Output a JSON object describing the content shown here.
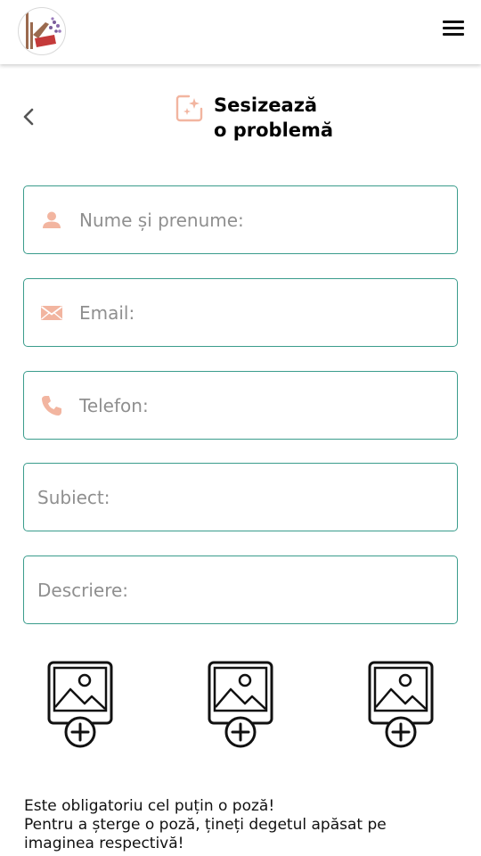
{
  "header": {
    "logo_name": "app-logo",
    "menu_icon": "hamburger-menu-icon"
  },
  "page": {
    "title_line1": "Sesizează",
    "title_line2": "o problemă",
    "title_icon": "photo-sparkle-icon",
    "back_icon": "chevron-left-icon"
  },
  "form": {
    "name": {
      "placeholder": "Nume și prenume:",
      "value": "",
      "icon": "person-icon"
    },
    "email": {
      "placeholder": "Email:",
      "value": "",
      "icon": "envelope-icon"
    },
    "phone": {
      "placeholder": "Telefon:",
      "value": "",
      "icon": "phone-icon"
    },
    "subject": {
      "placeholder": "Subiect:",
      "value": ""
    },
    "description": {
      "placeholder": "Descriere:",
      "value": ""
    }
  },
  "photos": [
    {
      "icon": "add-photo-icon"
    },
    {
      "icon": "add-photo-icon"
    },
    {
      "icon": "add-photo-icon"
    }
  ],
  "note": {
    "line1": "Este obligatoriu cel puțin o poză!",
    "line2": "Pentru a șterge o poză, țineți degetul apăsat pe imaginea respectivă!"
  },
  "colors": {
    "accent": "#3a9c8c",
    "icon_tint": "#f2b5a0",
    "placeholder": "#8f8f8f"
  }
}
